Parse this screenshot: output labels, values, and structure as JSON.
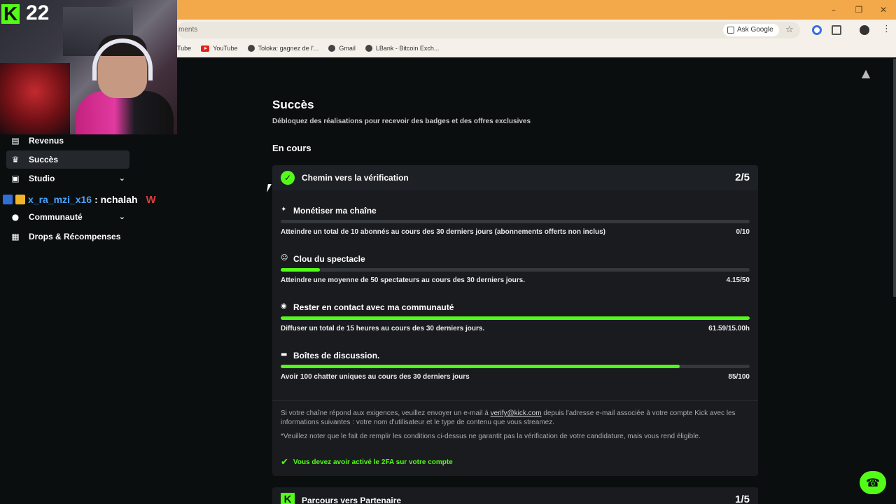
{
  "browser": {
    "url_fragment": "ments",
    "ask_google": "Ask Google",
    "bookmarks": [
      {
        "label": "Tube",
        "icon": "youtube-icon"
      },
      {
        "label": "YouTube",
        "icon": "youtube-icon"
      },
      {
        "label": "Toloka: gagnez de l'...",
        "icon": "globe-icon"
      },
      {
        "label": "Gmail",
        "icon": "globe-icon"
      },
      {
        "label": "LBank - Bitcoin Exch...",
        "icon": "globe-icon"
      }
    ]
  },
  "webcam": {
    "number": "22",
    "logo": "K"
  },
  "sidebar": {
    "items": [
      {
        "label": "Revenus",
        "icon": "chart-icon"
      },
      {
        "label": "Succès",
        "icon": "trophy-icon"
      },
      {
        "label": "Studio",
        "icon": "studio-icon"
      },
      {
        "label": "Communauté",
        "icon": "community-icon"
      },
      {
        "label": "Drops & Récompenses",
        "icon": "gift-icon"
      }
    ]
  },
  "chat": {
    "user": "x_ra_mzi_x16",
    "message": ": nchalah",
    "suffix": "W"
  },
  "main": {
    "title": "Succès",
    "subtitle": "Débloquez des réalisations pour recevoir des badges et des offres exclusives",
    "section": "En cours",
    "card": {
      "title": "Chemin vers la vérification",
      "count": "2/5",
      "tasks": [
        {
          "title": "Monétiser ma chaîne",
          "desc": "Atteindre un total de 10 abonnés au cours des 30 derniers jours (abonnements offerts non inclus)",
          "value": "0/10",
          "progress": 0
        },
        {
          "title": "Clou du spectacle",
          "desc": "Atteindre une moyenne de 50 spectateurs au cours des 30 derniers jours.",
          "value": "4.15/50",
          "progress": 0.083
        },
        {
          "title": "Rester en contact avec ma communauté",
          "desc": "Diffuser un total de 15 heures au cours des 30 derniers jours.",
          "value": "61.59/15.00h",
          "progress": 1
        },
        {
          "title": "Boîtes de discussion.",
          "desc": "Avoir 100 chatter uniques au cours des 30 derniers jours",
          "value": "85/100",
          "progress": 0.85
        }
      ],
      "note1_before": "Si votre chaîne répond aux exigences, veuillez envoyer un e-mail à ",
      "note1_email": "verify@kick.com",
      "note1_after": " depuis l'adresse e-mail associée à votre compte Kick avec les informations suivantes : votre nom d'utilisateur et le type de contenu que vous streamez.",
      "note2": "*Veuillez noter que le fait de remplir les conditions ci-dessus ne garantit pas la vérification de votre candidature, mais vous rend éligible.",
      "requirement": "Vous devez avoir activé le 2FA sur votre compte"
    },
    "card2": {
      "title": "Parcours vers Partenaire",
      "count": "1/5"
    }
  },
  "colors": {
    "accent": "#53fc18",
    "background": "#0b0e0f",
    "card": "#191b1f",
    "titlebar": "#f3a94a"
  }
}
